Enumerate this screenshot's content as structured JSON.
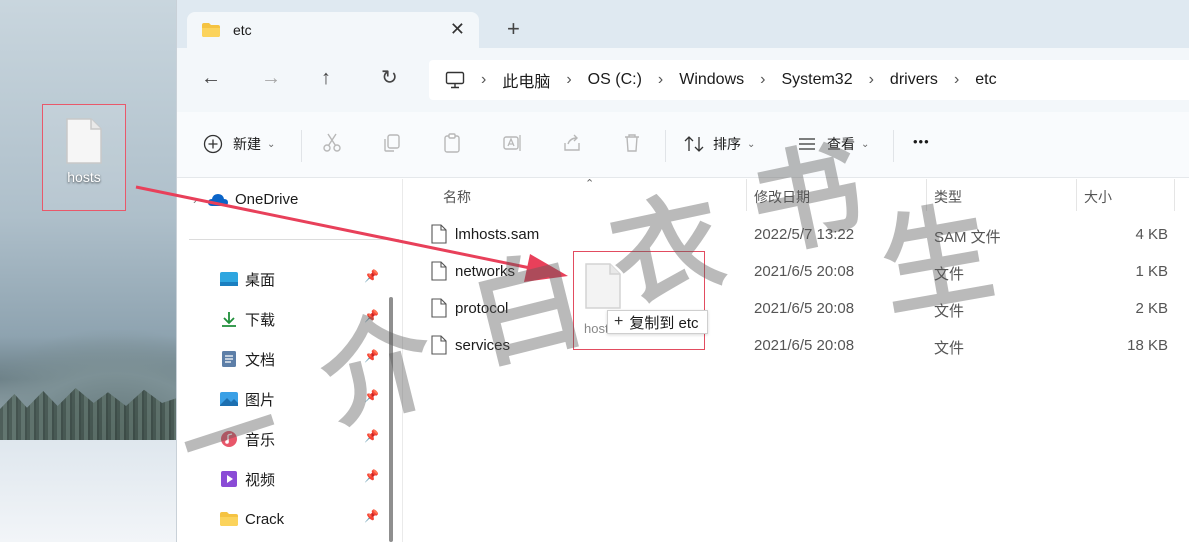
{
  "desktop": {
    "icon_label": "hosts"
  },
  "window": {
    "tab": {
      "title": "etc"
    },
    "address": {
      "crumbs": [
        "此电脑",
        "OS (C:)",
        "Windows",
        "System32",
        "drivers",
        "etc"
      ]
    },
    "toolbar": {
      "new_label": "新建",
      "sort_label": "排序",
      "view_label": "查看",
      "more_label": "•••"
    },
    "sidebar": {
      "onedrive_label": "OneDrive",
      "items": [
        {
          "label": "桌面",
          "icon": "desktop-icon"
        },
        {
          "label": "下载",
          "icon": "download-icon"
        },
        {
          "label": "文档",
          "icon": "document-icon"
        },
        {
          "label": "图片",
          "icon": "pictures-icon"
        },
        {
          "label": "音乐",
          "icon": "music-icon"
        },
        {
          "label": "视频",
          "icon": "video-icon"
        },
        {
          "label": "Crack",
          "icon": "folder-icon"
        }
      ]
    },
    "columns": {
      "name": "名称",
      "date": "修改日期",
      "type": "类型",
      "size": "大小"
    },
    "files": [
      {
        "name": "lmhosts.sam",
        "date": "2022/5/7 13:22",
        "type": "SAM 文件",
        "size": "4 KB"
      },
      {
        "name": "networks",
        "date": "2021/6/5 20:08",
        "type": "文件",
        "size": "1 KB"
      },
      {
        "name": "protocol",
        "date": "2021/6/5 20:08",
        "type": "文件",
        "size": "2 KB"
      },
      {
        "name": "services",
        "date": "2021/6/5 20:08",
        "type": "文件",
        "size": "18 KB"
      }
    ],
    "drag": {
      "ghost_name": "hosts",
      "tooltip": "复制到 etc"
    }
  },
  "colors": {
    "highlight_border": "#e9586a",
    "arrow": "#e8405a",
    "accent": "#0a64c8"
  }
}
